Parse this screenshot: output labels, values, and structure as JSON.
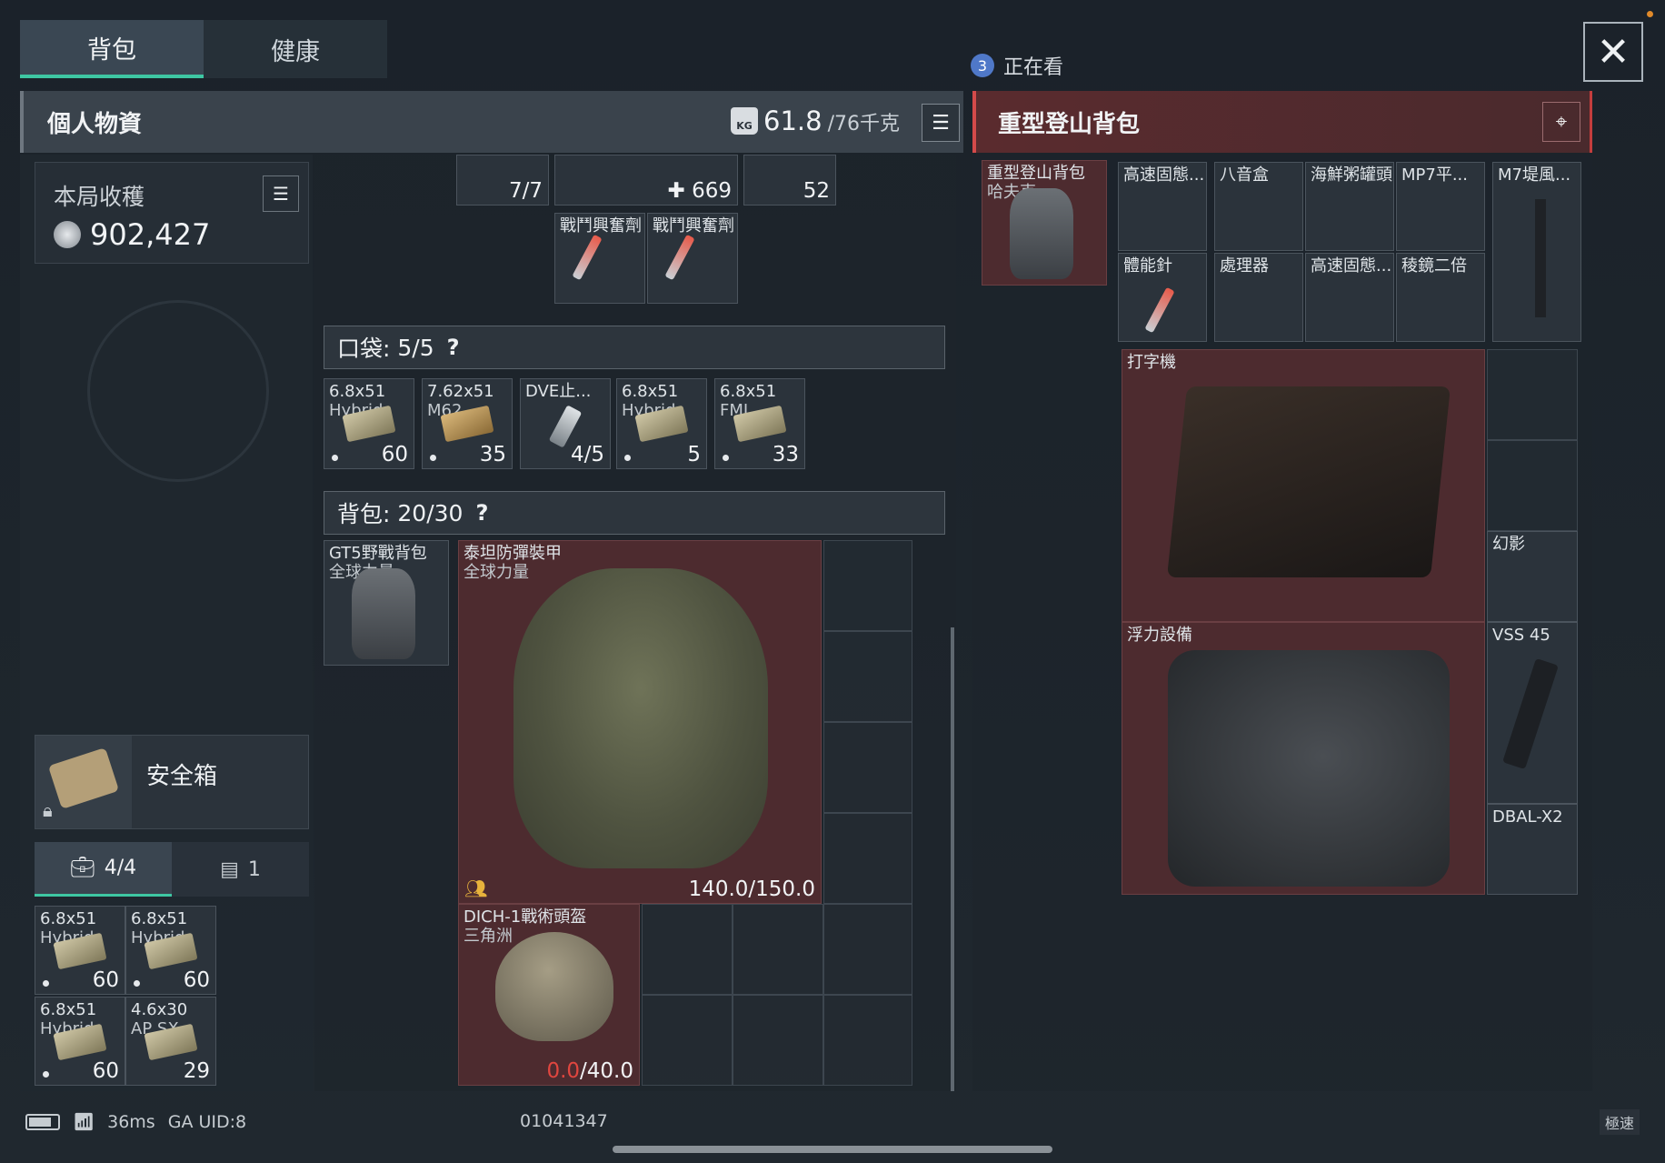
{
  "tabs": {
    "bag": "背包",
    "health": "健康"
  },
  "watching": {
    "count": "3",
    "label": "正在看"
  },
  "left_panel": {
    "title": "個人物資",
    "weight_current": "61.8",
    "weight_max": "/76千克",
    "kg_icon_text": "KG"
  },
  "right_panel": {
    "title": "重型登山背包"
  },
  "harvest": {
    "label": "本局收穫",
    "value": "902,427"
  },
  "top_strip": {
    "count_a": "7/7",
    "count_b": "669",
    "count_c": "52"
  },
  "stims": [
    {
      "name": "戰鬥興奮劑"
    },
    {
      "name": "戰鬥興奮劑"
    }
  ],
  "pocket": {
    "label": "口袋:",
    "count": "5/5",
    "help": "?",
    "items": [
      {
        "name": "6.8x51",
        "sub": "Hybrid",
        "count": "60"
      },
      {
        "name": "7.62x51",
        "sub": "M62",
        "count": "35"
      },
      {
        "name": "DVE止...",
        "sub": "",
        "count": "4/5"
      },
      {
        "name": "6.8x51",
        "sub": "Hybrid",
        "count": "5"
      },
      {
        "name": "6.8x51",
        "sub": "FMJ",
        "count": "33"
      }
    ]
  },
  "backpack": {
    "label": "背包:",
    "count": "20/30",
    "help": "?",
    "bag_item": {
      "name": "GT5野戰背包",
      "sub": "全球力量"
    },
    "vest": {
      "name": "泰坦防彈裝甲",
      "sub": "全球力量",
      "durability": "140.0/150.0"
    },
    "helmet": {
      "name": "DICH-1戰術頭盔",
      "sub": "三角洲",
      "durability_current": "0.0",
      "durability_max": "/40.0"
    }
  },
  "safebox": {
    "label": "安全箱"
  },
  "subtabs": {
    "case_count": "4/4",
    "other_count": "1"
  },
  "safe_items": [
    {
      "name": "6.8x51",
      "sub": "Hybrid",
      "count": "60"
    },
    {
      "name": "6.8x51",
      "sub": "Hybrid",
      "count": "60"
    },
    {
      "name": "6.8x51",
      "sub": "Hybrid",
      "count": "60"
    },
    {
      "name": "4.6x30",
      "sub": "AP SX",
      "count": "29"
    }
  ],
  "loot": {
    "container": {
      "name": "重型登山背包",
      "sub": "哈夫克"
    },
    "items": [
      "高速固態...",
      "八音盒",
      "海鮮粥罐頭",
      "MP7平...",
      "M7堤風...",
      "體能針",
      "處理器",
      "高速固態...",
      "稜鏡二倍",
      "打字機",
      "幻影",
      "浮力設備",
      "VSS 45",
      "DBAL-X2"
    ]
  },
  "status": {
    "ping": "36ms",
    "uid_label": "GA UID:8",
    "uid_tail": "01041347",
    "quality": "極速"
  },
  "colors": {
    "accent": "#3ec7a3",
    "loot_red": "#4d2b2f",
    "header_red": "#d44a4a"
  }
}
